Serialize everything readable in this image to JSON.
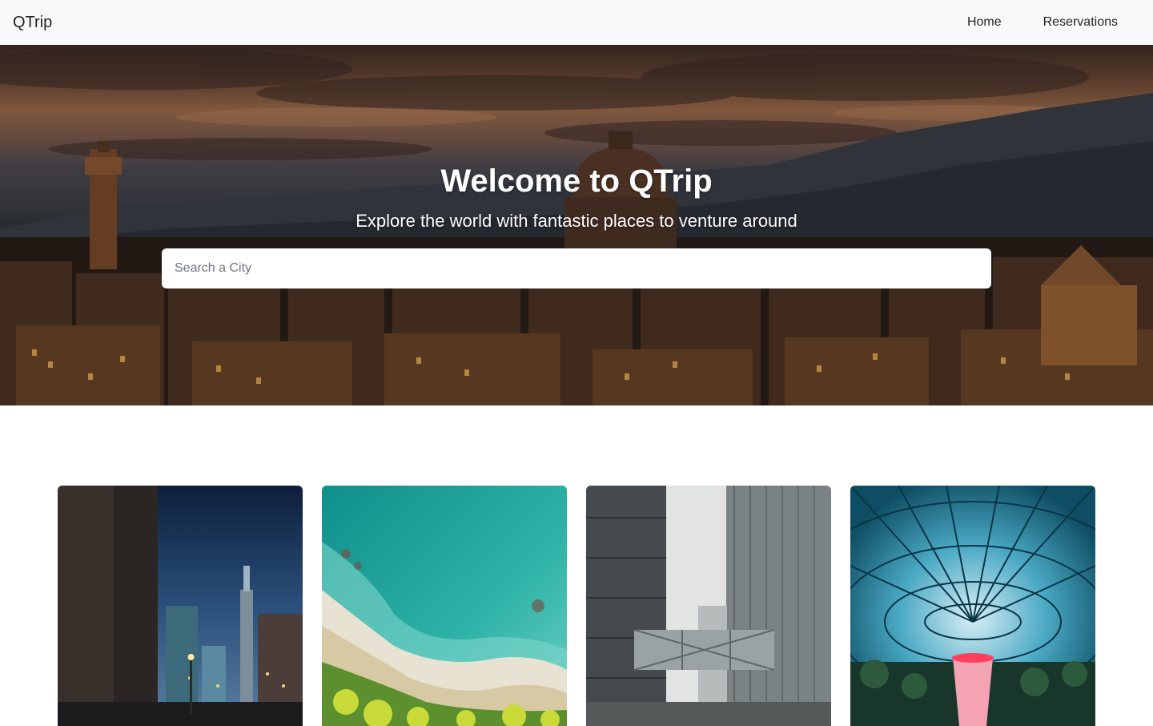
{
  "navbar": {
    "brand": "QTrip",
    "links": [
      {
        "label": "Home"
      },
      {
        "label": "Reservations"
      }
    ]
  },
  "hero": {
    "title": "Welcome to QTrip",
    "subtitle": "Explore the world with fantastic places to venture around",
    "search": {
      "placeholder": "Search a City",
      "value": ""
    }
  },
  "cities": [
    {
      "image": "night-city-street-photo"
    },
    {
      "image": "aerial-beach-ocean-photo"
    },
    {
      "image": "skyscraper-skybridge-photo"
    },
    {
      "image": "glass-dome-waterfall-photo"
    }
  ],
  "colors": {
    "navbar_bg": "#f8f9fa",
    "text": "#212529",
    "hero_text": "#ffffff"
  }
}
